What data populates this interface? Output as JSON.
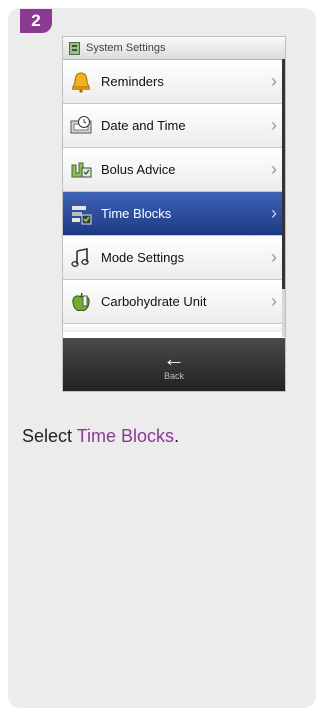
{
  "step": "2",
  "screen": {
    "title": "System Settings",
    "items": [
      {
        "label": "Reminders",
        "icon": "bell-icon",
        "selected": false
      },
      {
        "label": "Date and Time",
        "icon": "clock-icon",
        "selected": false
      },
      {
        "label": "Bolus Advice",
        "icon": "bolus-advice-icon",
        "selected": false
      },
      {
        "label": "Time Blocks",
        "icon": "time-blocks-icon",
        "selected": true
      },
      {
        "label": "Mode Settings",
        "icon": "music-note-icon",
        "selected": false
      },
      {
        "label": "Carbohydrate Unit",
        "icon": "apple-icon",
        "selected": false
      }
    ],
    "back_label": "Back"
  },
  "caption": {
    "prefix": "Select ",
    "link": "Time Blocks",
    "suffix": "."
  },
  "colors": {
    "accent": "#8a3a92",
    "selected_row": "#2a4a9e"
  }
}
